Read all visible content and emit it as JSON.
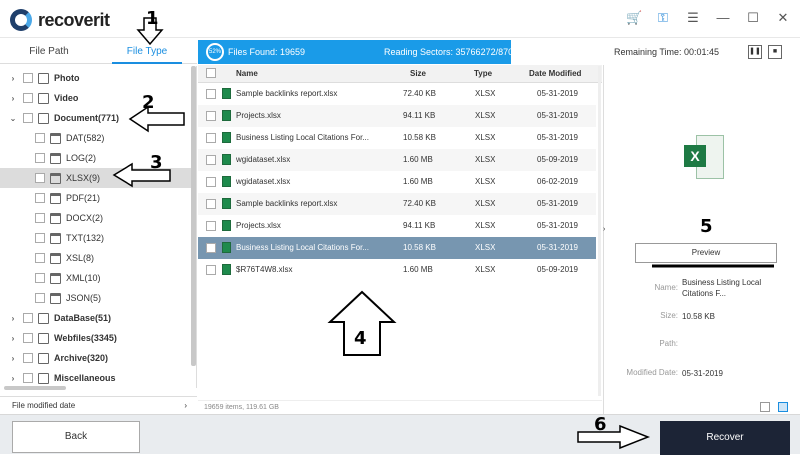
{
  "app": {
    "name": "recoverit"
  },
  "window": {
    "icons": [
      "cart-icon",
      "key-icon",
      "menu-icon",
      "minimize-icon",
      "maximize-icon",
      "close-icon"
    ]
  },
  "left_tabs": {
    "file_path": "File Path",
    "file_type": "File Type"
  },
  "tree": [
    {
      "label": "Photo",
      "level": 0,
      "caret": "›",
      "bold": true
    },
    {
      "label": "Video",
      "level": 0,
      "caret": "›",
      "bold": true
    },
    {
      "label": "Document(771)",
      "level": 0,
      "caret": "⌄",
      "bold": true
    },
    {
      "label": "DAT(582)",
      "level": 1
    },
    {
      "label": "LOG(2)",
      "level": 1
    },
    {
      "label": "XLSX(9)",
      "level": 1,
      "selected": true
    },
    {
      "label": "PDF(21)",
      "level": 1
    },
    {
      "label": "DOCX(2)",
      "level": 1
    },
    {
      "label": "TXT(132)",
      "level": 1
    },
    {
      "label": "XSL(8)",
      "level": 1
    },
    {
      "label": "XML(10)",
      "level": 1
    },
    {
      "label": "JSON(5)",
      "level": 1
    },
    {
      "label": "DataBase(51)",
      "level": 0,
      "caret": "›",
      "bold": true
    },
    {
      "label": "Webfiles(3345)",
      "level": 0,
      "caret": "›",
      "bold": true
    },
    {
      "label": "Archive(320)",
      "level": 0,
      "caret": "›",
      "bold": true
    },
    {
      "label": "Miscellaneous",
      "level": 0,
      "caret": "›",
      "bold": true
    }
  ],
  "left_footer": {
    "label": "File modified date",
    "chevron": "›"
  },
  "scan": {
    "percent": "52%",
    "progress": 0.52,
    "files_found": "Files Found:  19659",
    "reading": "Reading Sectors:  35766272/870402048",
    "remaining": "Remaining Time: 00:01:45",
    "pause": "❚❚",
    "stop": "■"
  },
  "table": {
    "headers": {
      "name": "Name",
      "size": "Size",
      "type": "Type",
      "date": "Date Modified"
    },
    "rows": [
      {
        "name": "Sample backlinks report.xlsx",
        "size": "72.40  KB",
        "type": "XLSX",
        "date": "05-31-2019"
      },
      {
        "name": "Projects.xlsx",
        "size": "94.11  KB",
        "type": "XLSX",
        "date": "05-31-2019"
      },
      {
        "name": "Business Listing  Local Citations For...",
        "size": "10.58  KB",
        "type": "XLSX",
        "date": "05-31-2019"
      },
      {
        "name": "wgidataset.xlsx",
        "size": "1.60  MB",
        "type": "XLSX",
        "date": "05-09-2019"
      },
      {
        "name": "wgidataset.xlsx",
        "size": "1.60  MB",
        "type": "XLSX",
        "date": "06-02-2019"
      },
      {
        "name": "Sample backlinks report.xlsx",
        "size": "72.40  KB",
        "type": "XLSX",
        "date": "05-31-2019"
      },
      {
        "name": "Projects.xlsx",
        "size": "94.11  KB",
        "type": "XLSX",
        "date": "05-31-2019"
      },
      {
        "name": "Business Listing  Local Citations For...",
        "size": "10.58  KB",
        "type": "XLSX",
        "date": "05-31-2019",
        "selected": true
      },
      {
        "name": "$R76T4W8.xlsx",
        "size": "1.60  MB",
        "type": "XLSX",
        "date": "05-09-2019"
      }
    ],
    "footer": "19659 items, 119.61  GB"
  },
  "detail": {
    "icon_letter": "X",
    "preview_label": "Preview",
    "name_label": "Name:",
    "name_value": "Business Listing  Local Citations F...",
    "size_label": "Size:",
    "size_value": "10.58  KB",
    "path_label": "Path:",
    "path_value": "",
    "modified_label": "Modified Date:",
    "modified_value": "05-31-2019",
    "caret": "›"
  },
  "bottom": {
    "back_label": "Back",
    "recover_label": "Recover"
  },
  "annotations": [
    "1",
    "2",
    "3",
    "4",
    "5",
    "6"
  ]
}
